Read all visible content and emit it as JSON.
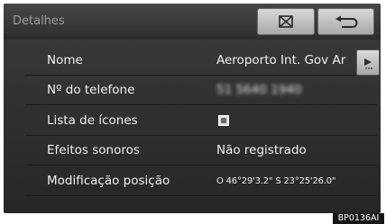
{
  "header": {
    "title": "Detalhes",
    "map_icon": "map-close-icon",
    "back_icon": "return-arrow-icon"
  },
  "rows": [
    {
      "label": "Nome",
      "value": "Aeroporto Int. Gov Ar"
    },
    {
      "label": "Nº do telefone",
      "value": "51 5640 1940"
    },
    {
      "label": "Lista de ícones",
      "value": ""
    },
    {
      "label": "Efeitos sonoros",
      "value": "Não registrado"
    },
    {
      "label": "Modificação posição",
      "value": "O 46°29'3.2\" S 23°25'26.0\""
    }
  ],
  "scroll_icon": "play-arrow-icon",
  "figure_code": "BP0136AI"
}
